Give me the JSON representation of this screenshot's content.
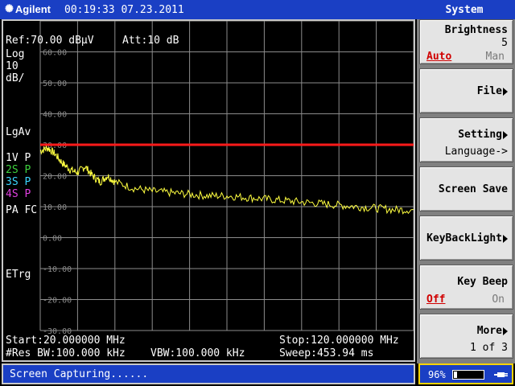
{
  "topbar": {
    "brand": "Agilent",
    "datetime": "00:19:33 07.23.2011",
    "menu_title": "System"
  },
  "display": {
    "ref": "Ref:70.00 dBµV",
    "att": "Att:10 dB",
    "scale_lines": [
      "Log",
      "10",
      "dB/"
    ],
    "lgav": "LgAv",
    "traces": [
      {
        "label": "1V P",
        "color": "#ffffff"
      },
      {
        "label": "2S P",
        "color": "#3dd13d"
      },
      {
        "label": "3S P",
        "color": "#3ad6ff"
      },
      {
        "label": "4S P",
        "color": "#e040e0"
      }
    ],
    "pafc": "PA FC",
    "etrg": "ETrg",
    "start": "Start:20.000000 MHz",
    "stop": "Stop:120.000000 MHz",
    "res_bw": "#Res BW:100.000 kHz",
    "vbw": "VBW:100.000 kHz",
    "sweep": "Sweep:453.94 ms",
    "y_tick_labels": [
      "60.00",
      "50.00",
      "40.00",
      "30.00",
      "20.00",
      "10.00",
      "0.00",
      "-10.00",
      "-20.00",
      "-30.00"
    ]
  },
  "chart_data": {
    "type": "line",
    "xlabel": "",
    "ylabel": "",
    "xlim": [
      20,
      120
    ],
    "ylim": [
      -30,
      70
    ],
    "y_scale_per_div": 10,
    "threshold_line": {
      "value": 30,
      "color": "#ff1a1a"
    },
    "series": [
      {
        "color": "#ffff40",
        "x": [
          20,
          22,
          24,
          26,
          28,
          30,
          32,
          34,
          36,
          38,
          40,
          45,
          50,
          55,
          60,
          65,
          70,
          75,
          80,
          85,
          90,
          95,
          100,
          105,
          110,
          115,
          120
        ],
        "y": [
          28,
          29,
          27,
          24,
          22,
          21,
          23,
          20,
          18,
          20,
          18,
          16,
          15,
          14.5,
          14,
          13.5,
          13.5,
          13,
          12.5,
          12,
          11.5,
          11,
          10.5,
          10,
          9.5,
          9,
          9
        ]
      }
    ]
  },
  "softkeys": {
    "brightness": {
      "label": "Brightness",
      "value": "5",
      "opt_left": "Auto",
      "opt_right": "Man"
    },
    "file": {
      "label": "File"
    },
    "setting": {
      "label": "Setting",
      "sub": "Language->"
    },
    "screen_save": {
      "label": "Screen Save"
    },
    "keybacklight": {
      "label": "KeyBackLight"
    },
    "key_beep": {
      "label": "Key Beep",
      "opt_left": "Off",
      "opt_right": "On"
    },
    "more": {
      "label": "More",
      "sub": "1 of 3"
    }
  },
  "status": {
    "message": "Screen Capturing......",
    "battery_pct": "96%",
    "battery_level": 0.1
  }
}
